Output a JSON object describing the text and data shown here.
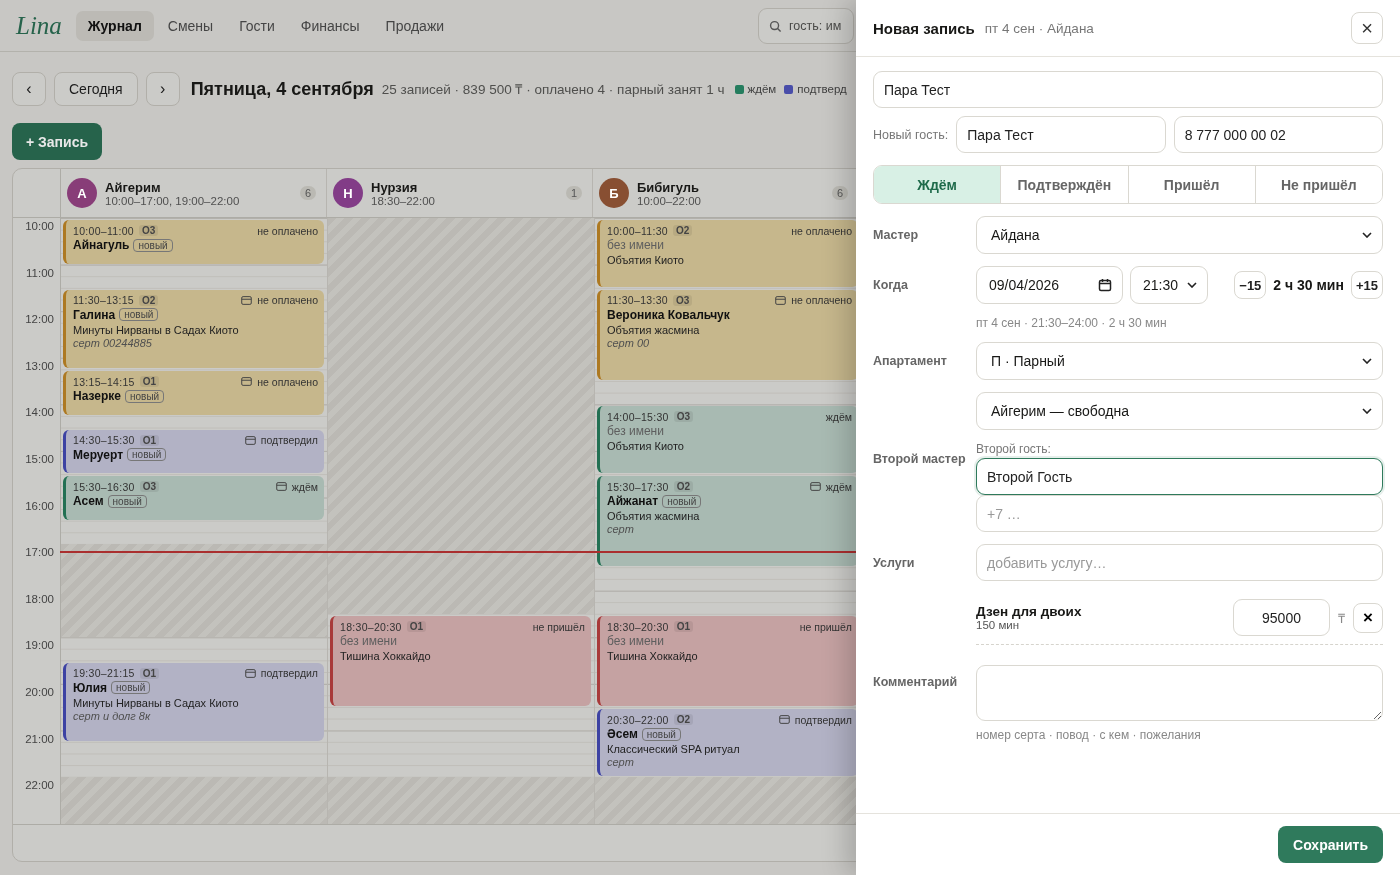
{
  "app": {
    "logo": "Lina",
    "nav": [
      {
        "label": "Журнал",
        "selected": true
      },
      {
        "label": "Смены",
        "selected": false
      },
      {
        "label": "Гости",
        "selected": false
      },
      {
        "label": "Финансы",
        "selected": false
      },
      {
        "label": "Продажи",
        "selected": false
      }
    ],
    "search": {
      "placeholder": "гость: им"
    }
  },
  "toolbar": {
    "prev": "‹",
    "today": "Сегодня",
    "next": "›",
    "title": "Пятница, 4 сентября",
    "summary": "25 записей · 839 500 ₸ · оплачено 4 · парный занят 1 ч",
    "legend": [
      {
        "label": "ждём",
        "color": "#257d5e"
      },
      {
        "label": "подтверд",
        "color": "#494da9"
      }
    ]
  },
  "add_button": "+ Запись",
  "calendar": {
    "hours": [
      "10:00",
      "11:00",
      "12:00",
      "13:00",
      "14:00",
      "15:00",
      "16:00",
      "17:00",
      "18:00",
      "19:00",
      "20:00",
      "21:00",
      "22:00"
    ],
    "masters": [
      {
        "initial": "А",
        "name": "Айгерим",
        "hours": "10:00–17:00, 19:00–22:00",
        "count": "6",
        "color": "#883d78",
        "events": [
          {
            "kind": "unpaid",
            "time": "10:00–11:00",
            "room": "О3",
            "name": "Айнагуль",
            "anonymous": false,
            "tag": "новый",
            "status": "не оплачено",
            "icon": false
          },
          {
            "kind": "unpaid",
            "time": "11:30–13:15",
            "room": "О2",
            "name": "Галина",
            "anonymous": false,
            "tag": "новый",
            "service": "Минуты Нирваны в Садах Киото",
            "note": "серт 00244885",
            "status": "не оплачено",
            "icon": true
          },
          {
            "kind": "unpaid",
            "time": "13:15–14:15",
            "room": "О1",
            "name": "Назерке",
            "anonymous": false,
            "tag": "новый",
            "status": "не оплачено",
            "icon": true
          },
          {
            "kind": "confirmed",
            "time": "14:30–15:30",
            "room": "О1",
            "name": "Меруерт",
            "anonymous": false,
            "tag": "новый",
            "status": "подтвердил",
            "icon": true
          },
          {
            "kind": "waiting",
            "time": "15:30–16:30",
            "room": "О3",
            "name": "Асем",
            "anonymous": false,
            "tag": "новый",
            "status": "ждём",
            "icon": true
          },
          {
            "kind": "confirmed",
            "time": "19:30–21:15",
            "room": "О1",
            "name": "Юлия",
            "anonymous": false,
            "tag": "новый",
            "service": "Минуты Нирваны в Садах Киото",
            "note": "серт и долг 8к",
            "status": "подтвердил",
            "icon": true
          }
        ]
      },
      {
        "initial": "Н",
        "name": "Нурзия",
        "hours": "18:30–22:00",
        "count": "1",
        "color": "#823c87",
        "events": [
          {
            "kind": "noshow",
            "time": "18:30–20:30",
            "room": "О1",
            "name": "без имени",
            "anonymous": true,
            "service": "Тишина Хоккайдо",
            "status": "не пришёл",
            "icon": false
          }
        ]
      },
      {
        "initial": "Б",
        "name": "Бибигуль",
        "hours": "10:00–22:00",
        "count": "6",
        "color": "#884f32",
        "events": [
          {
            "kind": "unpaid",
            "time": "10:00–11:30",
            "room": "О2",
            "name": "без имени",
            "anonymous": true,
            "service": "Объятия Киото",
            "status": "не оплачено",
            "icon": false
          },
          {
            "kind": "unpaid",
            "time": "11:30–13:30",
            "room": "О3",
            "name": "Вероника Ковальчук",
            "anonymous": false,
            "service": "Объятия жасмина",
            "note": "серт 00",
            "status": "не оплачено",
            "icon": true
          },
          {
            "kind": "waiting",
            "time": "14:00–15:30",
            "room": "О3",
            "name": "без имени",
            "anonymous": true,
            "service": "Объятия Киото",
            "status": "ждём",
            "icon": false
          },
          {
            "kind": "waiting",
            "time": "15:30–17:30",
            "room": "О2",
            "name": "Айжанат",
            "anonymous": false,
            "tag": "новый",
            "service": "Объятия жасмина",
            "note": "серт",
            "status": "ждём",
            "icon": true
          },
          {
            "kind": "noshow",
            "time": "18:30–20:30",
            "room": "О1",
            "name": "без имени",
            "anonymous": true,
            "service": "Тишина Хоккайдо",
            "status": "не пришёл",
            "icon": false
          },
          {
            "kind": "confirmed",
            "time": "20:30–22:00",
            "room": "О2",
            "name": "Әсем",
            "anonymous": false,
            "tag": "новый",
            "service": "Классический SPA ритуал",
            "note": "серт",
            "status": "подтвердил",
            "icon": true
          }
        ]
      }
    ]
  },
  "drawer": {
    "title": "Новая запись",
    "subtitle": "пт 4 сен · Айдана",
    "close": "×",
    "guest_search": {
      "value": "Пара Тест"
    },
    "new_guest": {
      "label": "Новый гость:",
      "name": "Пара Тест",
      "phone": "8 777 000 00 02"
    },
    "statuses": [
      {
        "label": "Ждём",
        "selected": true
      },
      {
        "label": "Подтверждён",
        "selected": false
      },
      {
        "label": "Пришёл",
        "selected": false
      },
      {
        "label": "Не пришёл",
        "selected": false
      }
    ],
    "master": {
      "label": "Мастер",
      "value": "Айдана"
    },
    "when": {
      "label": "Когда",
      "date": "09/04/2026",
      "time": "21:30",
      "minus": "−15",
      "duration": "2 ч 30 мин",
      "plus": "+15",
      "hint": "пт 4 сен · 21:30–24:00 · 2 ч 30 мин"
    },
    "apartment": {
      "label": "Апартамент",
      "value": "П · Парный",
      "second_value": "Айгерим — свободна"
    },
    "second_master": {
      "label": "Второй мастер",
      "guest_label": "Второй гость:",
      "guest_value": "Второй Гость",
      "phone_placeholder": "+7 …"
    },
    "services": {
      "label": "Услуги",
      "placeholder": "добавить услугу…",
      "items": [
        {
          "name": "Дзен для двоих",
          "duration": "150 мин",
          "price": "95000",
          "currency": "₸",
          "remove": "×"
        }
      ]
    },
    "comment": {
      "label": "Комментарий",
      "hint": "номер серта · повод · с кем · пожелания"
    },
    "save": "Сохранить"
  }
}
